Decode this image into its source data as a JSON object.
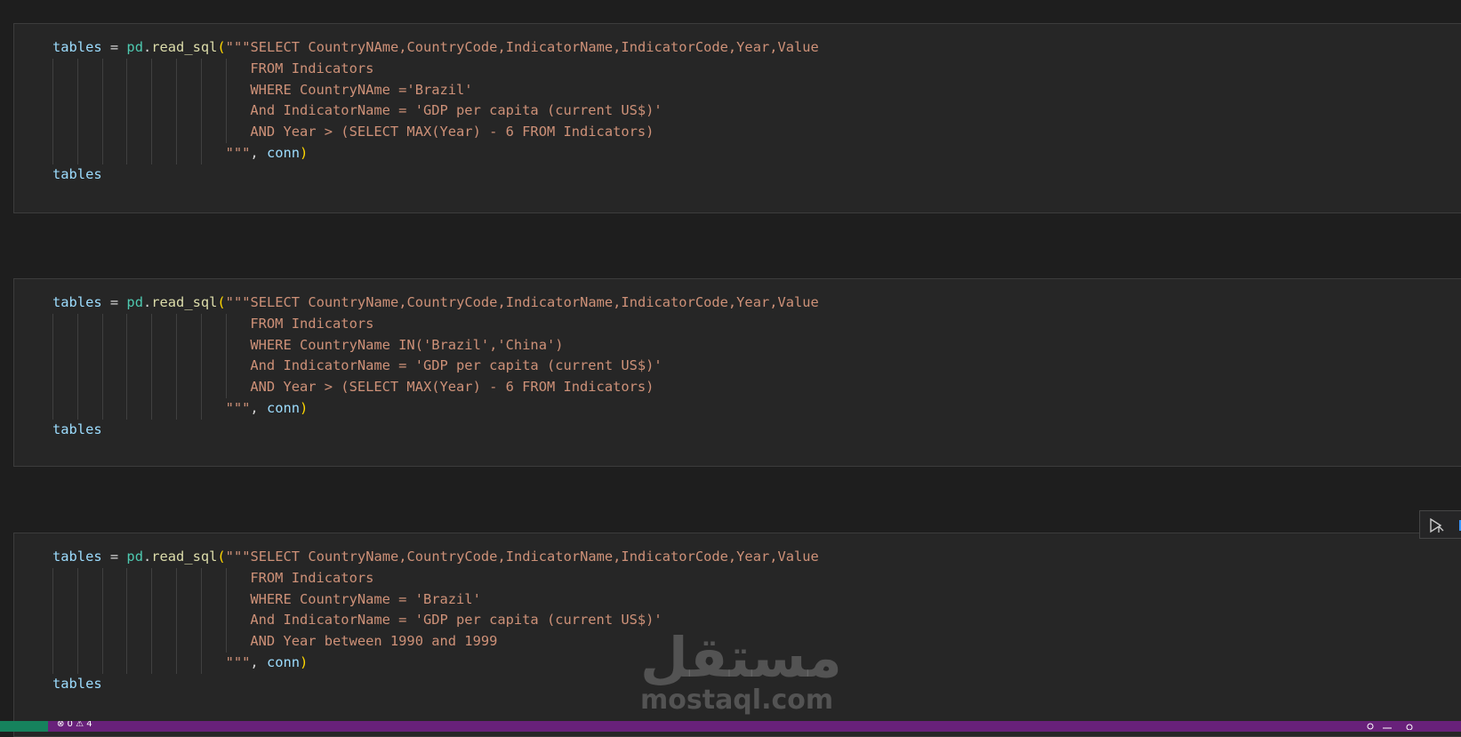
{
  "cells": [
    {
      "lines": [
        [
          [
            "tables",
            "var"
          ],
          [
            " = ",
            "op"
          ],
          [
            "pd",
            "mod"
          ],
          [
            ".",
            "op"
          ],
          [
            "read_sql",
            "fn"
          ],
          [
            "(",
            "par"
          ],
          [
            "\"\"\"SELECT CountryNAme,CountryCode,IndicatorName,IndicatorCode,Year,Value",
            "str"
          ]
        ],
        [
          [
            "                        FROM Indicators",
            "str"
          ]
        ],
        [
          [
            "                        WHERE CountryNAme ='Brazil'",
            "str"
          ]
        ],
        [
          [
            "                        And IndicatorName = 'GDP per capita (current US$)'",
            "str"
          ]
        ],
        [
          [
            "                        AND Year > (SELECT MAX(Year) - 6 FROM Indicators)",
            "str"
          ]
        ],
        [
          [
            "                     \"\"\"",
            "str"
          ],
          [
            ", ",
            "op"
          ],
          [
            "conn",
            "var"
          ],
          [
            ")",
            "par"
          ]
        ],
        [
          [
            "tables",
            "var"
          ]
        ]
      ]
    },
    {
      "lines": [
        [
          [
            "tables",
            "var"
          ],
          [
            " = ",
            "op"
          ],
          [
            "pd",
            "mod"
          ],
          [
            ".",
            "op"
          ],
          [
            "read_sql",
            "fn"
          ],
          [
            "(",
            "par"
          ],
          [
            "\"\"\"SELECT CountryName,CountryCode,IndicatorName,IndicatorCode,Year,Value",
            "str"
          ]
        ],
        [
          [
            "                        FROM Indicators",
            "str"
          ]
        ],
        [
          [
            "                        WHERE CountryName IN('Brazil','China')",
            "str"
          ]
        ],
        [
          [
            "                        And IndicatorName = 'GDP per capita (current US$)'",
            "str"
          ]
        ],
        [
          [
            "                        AND Year > (SELECT MAX(Year) - 6 FROM Indicators)",
            "str"
          ]
        ],
        [
          [
            "                     \"\"\"",
            "str"
          ],
          [
            ", ",
            "op"
          ],
          [
            "conn",
            "var"
          ],
          [
            ")",
            "par"
          ]
        ],
        [
          [
            "tables",
            "var"
          ]
        ]
      ]
    },
    {
      "lines": [
        [
          [
            "tables",
            "var"
          ],
          [
            " = ",
            "op"
          ],
          [
            "pd",
            "mod"
          ],
          [
            ".",
            "op"
          ],
          [
            "read_sql",
            "fn"
          ],
          [
            "(",
            "par"
          ],
          [
            "\"\"\"SELECT CountryName,CountryCode,IndicatorName,IndicatorCode,Year,Value",
            "str"
          ]
        ],
        [
          [
            "                        FROM Indicators",
            "str"
          ]
        ],
        [
          [
            "                        WHERE CountryName = 'Brazil'",
            "str"
          ]
        ],
        [
          [
            "                        And IndicatorName = 'GDP per capita (current US$)'",
            "str"
          ]
        ],
        [
          [
            "                        AND Year between 1990 and 1999",
            "str"
          ]
        ],
        [
          [
            "                     \"\"\"",
            "str"
          ],
          [
            ", ",
            "op"
          ],
          [
            "conn",
            "var"
          ],
          [
            ")",
            "par"
          ]
        ],
        [
          [
            "tables",
            "var"
          ]
        ]
      ]
    }
  ],
  "toolbar": {
    "run_icon": "run-by-line-icon"
  },
  "watermark": {
    "arabic": "مستقل",
    "latin": "mostaql.com"
  },
  "statusbar": {
    "problems": "⊗ 0 ⚠ 4"
  },
  "colors": {
    "variable": "#9cdcfe",
    "module": "#4ec9b0",
    "function": "#dcdcaa",
    "bracket": "#ffd700",
    "string": "#ce9178",
    "statusbar": "#68217a"
  }
}
